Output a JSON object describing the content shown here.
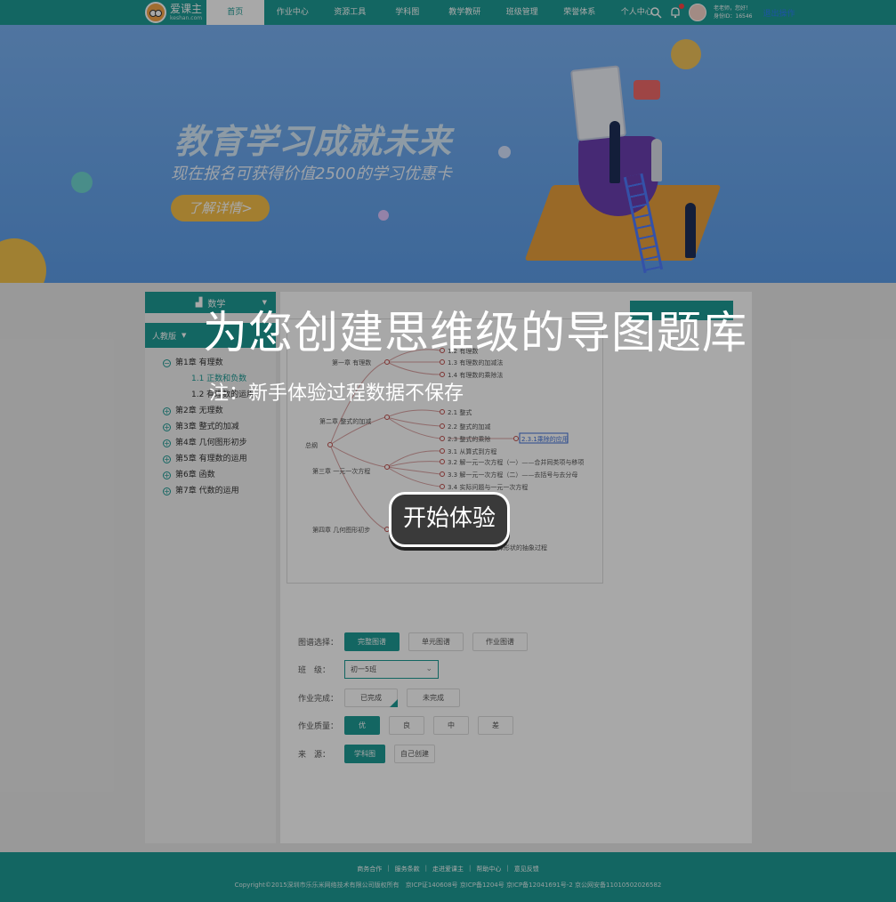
{
  "header": {
    "logo_main": "爱课主",
    "logo_sub": "keshan.com",
    "nav": [
      "首页",
      "作业中心",
      "资源工具",
      "学科图",
      "教学教研",
      "班级管理",
      "荣誉体系",
      "个人中心"
    ],
    "active_nav": "首页",
    "user_greeting": "老老师，您好！",
    "user_id": "身份ID：16546",
    "exit_label": "退出操作",
    "notification_count": "1"
  },
  "banner": {
    "title": "教育学习成就未来",
    "subtitle": "现在报名可获得价值2500的学习优惠卡",
    "button": "了解详情>"
  },
  "sidebar": {
    "subject": "数学",
    "edition": "人教版",
    "chapters": [
      {
        "label": "第1章  有理数",
        "expanded": true
      },
      {
        "label": "第2章  无理数"
      },
      {
        "label": "第3章  整式的加减"
      },
      {
        "label": "第4章  几何图形初步"
      },
      {
        "label": "第5章  有理数的运用"
      },
      {
        "label": "第6章  函数"
      },
      {
        "label": "第7章  代数的运用"
      }
    ],
    "sub_items": [
      "1.1  正数和负数",
      "1.2  有理数的运用"
    ]
  },
  "mindmap": {
    "root": "总纲",
    "branches": [
      "第一章 有理数",
      "第二章 整式的加减",
      "第三章 一元一次方程",
      "第四章 几何图形初步"
    ],
    "leaves": [
      "1.2 有理数",
      "1.3 有理数的加减法",
      "1.4 有理数的乘除法",
      "2.1 整式",
      "2.2 整式的加减",
      "2.3 整式的乘除",
      "2.3.1乘除的应用",
      "3.1 从算式到方程",
      "3.2 解一元一次方程（一）——合并同类项与移项",
      "3.3 解一元一次方程（二）——去括号与去分母",
      "3.4 实际问题与一元一次方程",
      "从不同方向看几何体形状的抽象过程"
    ]
  },
  "filters": {
    "map_label": "图谱选择：",
    "map_options": [
      "完整图谱",
      "单元图谱",
      "作业图谱"
    ],
    "class_label": "班　级：",
    "class_value": "初一5班",
    "done_label": "作业完成：",
    "done_options": [
      "已完成",
      "未完成"
    ],
    "quality_label": "作业质量：",
    "quality_options": [
      "优",
      "良",
      "中",
      "差"
    ],
    "source_label": "来　源：",
    "source_options": [
      "学科图",
      "自己创建"
    ]
  },
  "footer": {
    "links": [
      "商务合作",
      "服务条款",
      "走进爱课主",
      "帮助中心",
      "意见反馈"
    ],
    "copyright": "Copyright©2015深圳市乐乐米网络技术有限公司版权所有　京ICP证140608号 京ICP备1204号 京ICP备12041691号-2 京公网安备11010502026582"
  },
  "overlay": {
    "title": "为您创建思维级的导图题库",
    "note": "注：新手体验过程数据不保存",
    "start": "开始体验"
  },
  "colors": {
    "primary": "#1e9b95",
    "banner": "#6aa7ee",
    "accent": "#f6c04a"
  }
}
